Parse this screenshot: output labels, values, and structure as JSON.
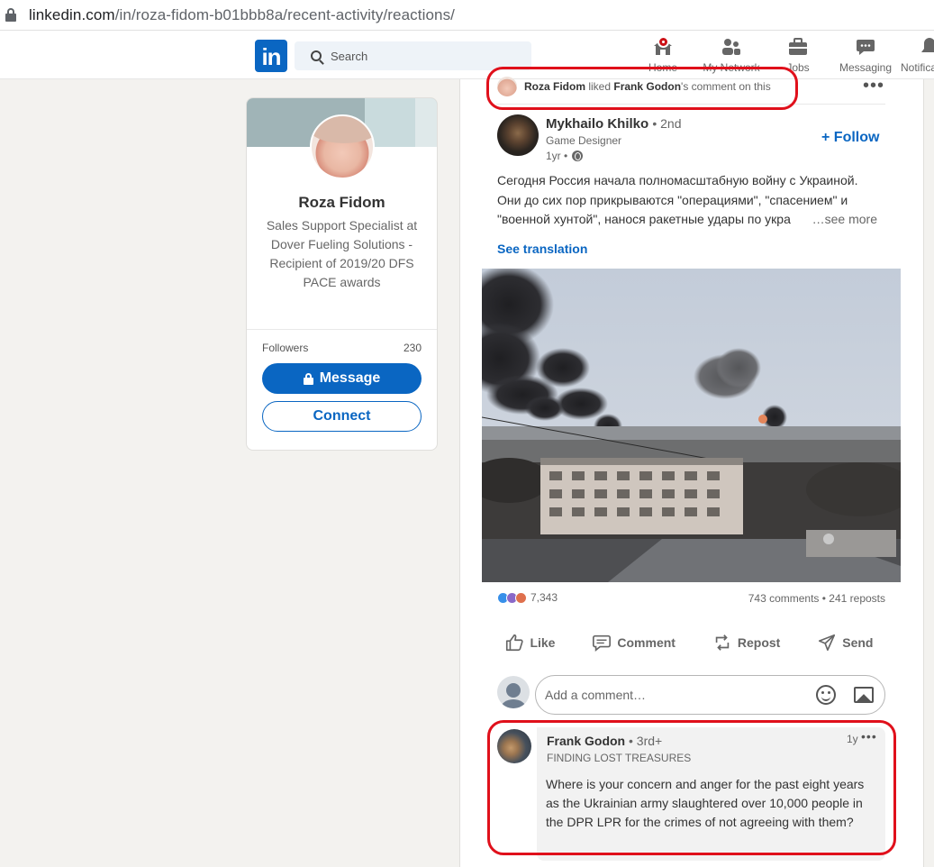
{
  "browser": {
    "url_host": "linkedin.com",
    "url_path": "/in/roza-fidom-b01bbb8a/recent-activity/reactions/"
  },
  "nav": {
    "logo": "in",
    "search_placeholder": "Search",
    "items": [
      {
        "label": "Home",
        "icon": "home-icon"
      },
      {
        "label": "My Network",
        "icon": "network-icon"
      },
      {
        "label": "Jobs",
        "icon": "briefcase-icon"
      },
      {
        "label": "Messaging",
        "icon": "messaging-icon"
      },
      {
        "label": "Notifications",
        "icon": "bell-icon"
      }
    ]
  },
  "profile": {
    "name": "Roza Fidom",
    "headline": "Sales Support Specialist at Dover Fueling Solutions - Recipient of 2019/20 DFS PACE awards",
    "followers_label": "Followers",
    "followers_count": "230",
    "message_label": "Message",
    "connect_label": "Connect"
  },
  "activity": {
    "actor": "Roza Fidom",
    "verb": "liked",
    "target": "Frank Godon",
    "suffix": "'s comment on this"
  },
  "post": {
    "author": "Mykhailo Khilko",
    "degree": "• 2nd",
    "title": "Game Designer",
    "time": "1yr •",
    "follow_label": "Follow",
    "text_lines": [
      "Сегодня Россия начала полномасштабную войну с Украиной.",
      "Они до сих пор прикрываются \"операциями\", \"спасением\" и",
      "\"военной хунтой\", нанося ракетные удары по укра"
    ],
    "see_more": "…see more",
    "see_translation": "See translation",
    "reactions_count": "7,343",
    "counts": "743 comments • 241 reposts",
    "actions": [
      "Like",
      "Comment",
      "Repost",
      "Send"
    ],
    "comment_placeholder": "Add a comment…"
  },
  "comment": {
    "author": "Frank Godon",
    "degree": "• 3rd+",
    "headline": "FINDING LOST TREASURES",
    "time": "1y",
    "text": "Where is your concern and anger for the past eight years as the Ukrainian army slaughtered over 10,000 people in the DPR LPR for the crimes of not agreeing with them?"
  },
  "colors": {
    "brand": "#0a66c2",
    "annotation_red": "#e0101b",
    "badge_red": "#cc1016"
  }
}
